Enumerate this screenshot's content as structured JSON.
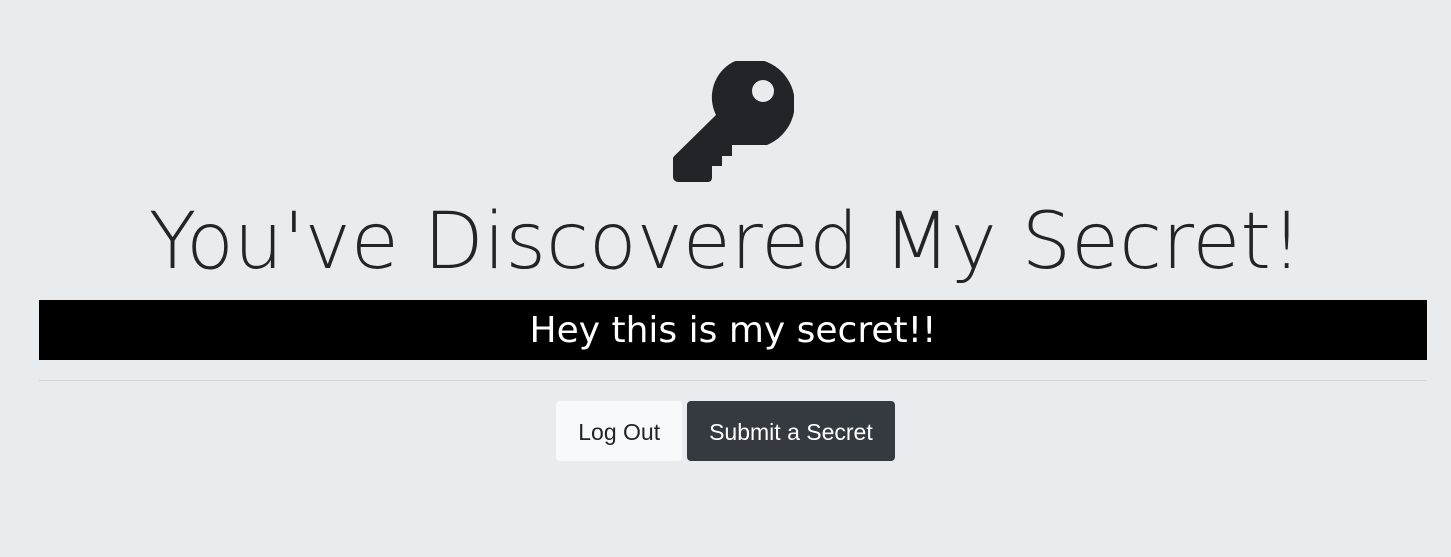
{
  "icons": {
    "hero": "key-icon"
  },
  "hero": {
    "title": "You've Discovered My Secret!"
  },
  "secret": {
    "text": "Hey this is my secret!!"
  },
  "actions": {
    "logout_label": "Log Out",
    "submit_label": "Submit a Secret"
  },
  "colors": {
    "background": "#e9ecef",
    "text": "#212529",
    "banner_background": "#000000",
    "banner_text": "#ffffff",
    "light_button": "#f8f9fa",
    "dark_button": "#343a40"
  }
}
